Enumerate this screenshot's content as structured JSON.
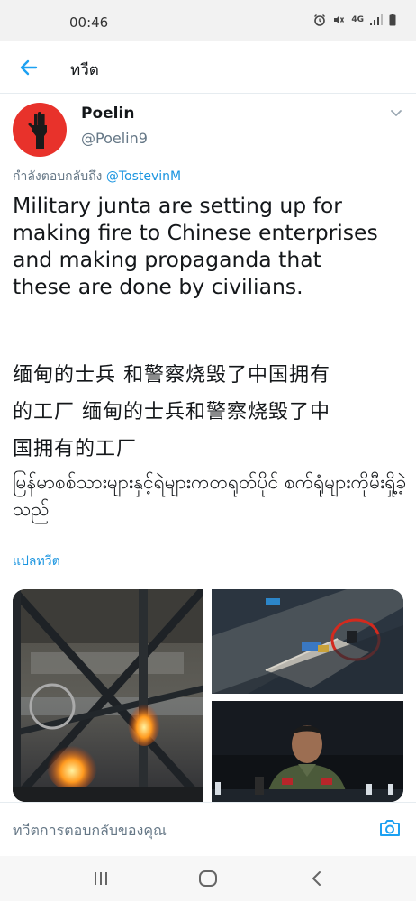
{
  "status_bar": {
    "time": "00:46",
    "network": "4G"
  },
  "header": {
    "title": "ทวีต"
  },
  "tweet": {
    "author_name": "Poelin",
    "author_handle": "@Poelin9",
    "reply_prefix": "กำลังตอบกลับถึง",
    "reply_handle": "@TostevinM",
    "text_en": "Military junta are setting up for\nmaking fire to Chinese enterprises\nand making propaganda that\nthese are done by civilians.",
    "text_cn": "缅甸的士兵 和警察烧毁了中国拥有\n的工厂 缅甸的士兵和警察烧毁了中\n国拥有的工厂",
    "text_my": "မြန်မာစစ်သားများနှင့်ရဲများကတရုတ်ပိုင် စက်ရုံများကိုမီးရှို့ခဲ့သည်",
    "translate_label": "แปลทวีต"
  },
  "reply_bar": {
    "placeholder": "ทวีตการตอบกลับของคุณ"
  },
  "icons": {
    "back": "arrow-left-icon",
    "more": "chevron-down-icon",
    "camera": "camera-icon",
    "nav_recent": "recent-apps-icon",
    "nav_home": "home-icon",
    "nav_back": "back-nav-icon"
  },
  "colors": {
    "accent": "#1da1f2",
    "link": "#1b95e0",
    "muted": "#657786",
    "avatar_bg": "#e8322b"
  }
}
